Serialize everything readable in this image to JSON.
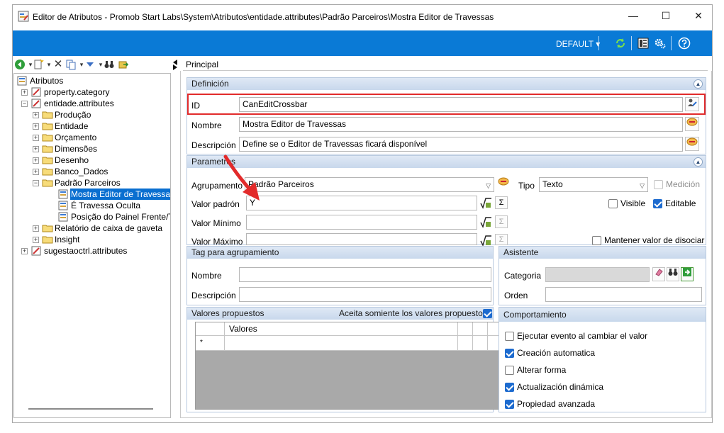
{
  "window": {
    "title": "Editor de Atributos - Promob Start Labs\\System\\Atributos\\entidade.attributes\\Padrão Parceiros\\Mostra Editor de Travessas",
    "controls": {
      "minimize": "—",
      "maximize": "☐",
      "close": "✕"
    }
  },
  "toolbar": {
    "profile": "DEFAULT"
  },
  "tree": {
    "items": [
      {
        "label": "Atributos",
        "level": 0
      },
      {
        "label": "property.category",
        "level": 1
      },
      {
        "label": "entidade.attributes",
        "level": 1
      },
      {
        "label": "Produção",
        "level": 2
      },
      {
        "label": "Entidade",
        "level": 2
      },
      {
        "label": "Orçamento",
        "level": 2
      },
      {
        "label": "Dimensões",
        "level": 2
      },
      {
        "label": "Desenho",
        "level": 2
      },
      {
        "label": "Banco_Dados",
        "level": 2
      },
      {
        "label": "Padrão Parceiros",
        "level": 2
      },
      {
        "label": "Mostra Editor de Travessas",
        "level": 3,
        "selected": true
      },
      {
        "label": "É Travessa Oculta",
        "level": 3
      },
      {
        "label": "Posição do Painel Frente/Tr",
        "level": 3
      },
      {
        "label": "Relatório de caixa de gaveta",
        "level": 2
      },
      {
        "label": "Insight",
        "level": 2
      },
      {
        "label": "sugestaoctrl.attributes",
        "level": 1
      }
    ]
  },
  "tabs": {
    "active": "Principal"
  },
  "definicion": {
    "header": "Definición",
    "id_label": "ID",
    "id_value": "CanEditCrossbar",
    "nombre_label": "Nombre",
    "nombre_value": "Mostra Editor de Travessas",
    "descripcion_label": "Descripción",
    "descripcion_value": "Define se o Editor de Travessas ficará disponível"
  },
  "parametros": {
    "header": "Parametros",
    "agrupamiento_label": "Agrupamento",
    "agrupamiento_value": "Padrão Parceiros",
    "tipo_label": "Tipo",
    "tipo_value": "Texto",
    "medicion_label": "Medición",
    "valor_padron_label": "Valor padrón",
    "valor_padron_value": "Y",
    "valor_minimo_label": "Valor Mínimo",
    "valor_maximo_label": "Valor Máximo",
    "visible_label": "Visible",
    "editable_label": "Editable",
    "mantener_label": "Mantener valor de disociar",
    "sigma": "Σ"
  },
  "tag": {
    "header": "Tag para agrupamiento",
    "nombre_label": "Nombre",
    "descripcion_label": "Descripción"
  },
  "asistente": {
    "header": "Asistente",
    "categoria_label": "Categoria",
    "orden_label": "Orden"
  },
  "valores": {
    "header": "Valores propuestos",
    "accept_label": "Aceita somiente los valores propuestos",
    "col_valores": "Valores",
    "new_row_marker": "*"
  },
  "comportamiento": {
    "header": "Comportamiento",
    "items": [
      {
        "label": "Ejecutar evento al cambiar el valor",
        "checked": false
      },
      {
        "label": "Creación automatica",
        "checked": true
      },
      {
        "label": "Alterar forma",
        "checked": false
      },
      {
        "label": "Actualización dinámica",
        "checked": true
      },
      {
        "label": "Propiedad avanzada",
        "checked": true
      }
    ]
  },
  "colors": {
    "accent": "#0a7ad6",
    "highlight": "#e22b2b",
    "selection": "#0a6fd0"
  }
}
